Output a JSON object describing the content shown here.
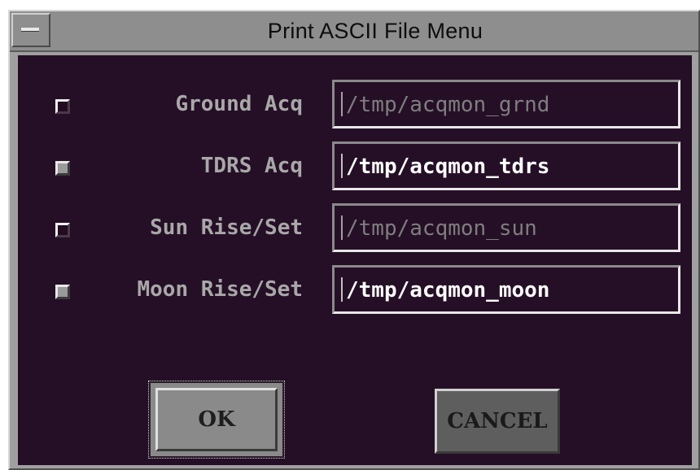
{
  "window": {
    "title": "Print ASCII File Menu"
  },
  "rows": [
    {
      "label": "Ground Acq",
      "checked": false,
      "enabled": false,
      "value": "/tmp/acqmon_grnd"
    },
    {
      "label": "TDRS Acq",
      "checked": true,
      "enabled": true,
      "value": "/tmp/acqmon_tdrs"
    },
    {
      "label": "Sun Rise/Set",
      "checked": false,
      "enabled": false,
      "value": "/tmp/acqmon_sun"
    },
    {
      "label": "Moon Rise/Set",
      "checked": true,
      "enabled": true,
      "value": "/tmp/acqmon_moon"
    }
  ],
  "buttons": {
    "ok_label": "OK",
    "cancel_label": "CANCEL"
  },
  "colors": {
    "background": "#250f26",
    "frame": "#8e8e8e",
    "enabled_text": "#ffffff",
    "disabled_text": "#7e7e7e",
    "label_text": "#a8a8a8"
  }
}
